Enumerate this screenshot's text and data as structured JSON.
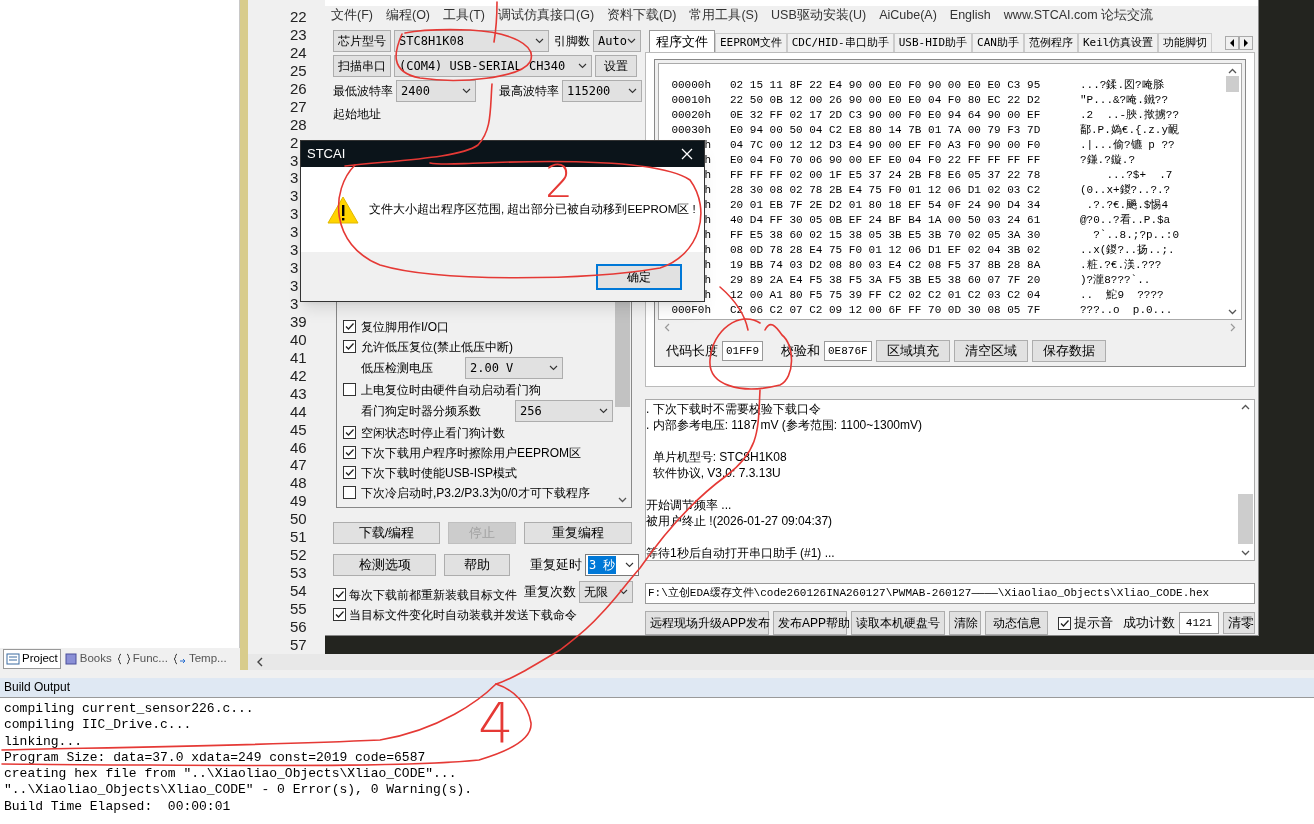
{
  "editor": {
    "line_numbers": [
      "22",
      "23",
      "24",
      "25",
      "26",
      "27",
      "28",
      "2",
      "3",
      "3",
      "3",
      "3",
      "3",
      "3",
      "3",
      "3",
      "3",
      "39",
      "40",
      "41",
      "42",
      "43",
      "44",
      "45",
      "46",
      "47",
      "48",
      "49",
      "50",
      "51",
      "52",
      "53",
      "54",
      "55",
      "56",
      "57"
    ],
    "panel_tabs": [
      {
        "label": "Project",
        "selected": true
      },
      {
        "label": "Books",
        "selected": false
      },
      {
        "label": "Func...",
        "selected": false
      },
      {
        "label": "Temp...",
        "selected": false
      }
    ]
  },
  "build_output": {
    "title": "Build Output",
    "lines": [
      "compiling current_sensor226.c...",
      "compiling IIC_Drive.c...",
      "linking...",
      "Program Size: data=37.0 xdata=249 const=2019 code=6587",
      "creating hex file from \"..\\Xiaoliao_Objects\\Xliao_CODE\"...",
      "\"..\\Xiaoliao_Objects\\Xliao_CODE\" - 0 Error(s), 0 Warning(s).",
      "Build Time Elapsed:  00:00:01"
    ]
  },
  "isp": {
    "menu": [
      "文件(F)",
      "编程(O)",
      "工具(T)",
      "调试仿真接口(G)",
      "资料下载(D)",
      "常用工具(S)",
      "USB驱动安装(U)",
      "AiCube(A)",
      "English",
      "www.STCAI.com 论坛交流"
    ],
    "chip": {
      "button": "芯片型号",
      "value": "STC8H1K08",
      "pins_label": "引脚数",
      "pins_value": "Auto"
    },
    "port": {
      "button": "扫描串口",
      "value": "(COM4) USB-SERIAL CH340",
      "settings": "设置"
    },
    "baud": {
      "min_label": "最低波特率",
      "min_value": "2400",
      "max_label": "最高波特率",
      "max_value": "115200"
    },
    "start_address_label": "起始地址",
    "options": [
      {
        "kind": "checkbox",
        "label": "复位脚用作I/O口",
        "checked": true
      },
      {
        "kind": "checkbox",
        "label": "允许低压复位(禁止低压中断)",
        "checked": true
      },
      {
        "kind": "select",
        "label": "低压检测电压",
        "value": "2.00 V"
      },
      {
        "kind": "checkbox",
        "label": "上电复位时由硬件自动启动看门狗",
        "checked": false
      },
      {
        "kind": "select",
        "label": "看门狗定时器分频系数",
        "value": "256"
      },
      {
        "kind": "checkbox",
        "label": "空闲状态时停止看门狗计数",
        "checked": true
      },
      {
        "kind": "checkbox",
        "label": "下次下载用户程序时擦除用户EEPROM区",
        "checked": true
      },
      {
        "kind": "checkbox",
        "label": "下次下载时使能USB-ISP模式",
        "checked": true
      },
      {
        "kind": "checkbox",
        "label": "下次冷启动时,P3.2/P3.3为0/0才可下载程序",
        "checked": false
      }
    ],
    "actions": [
      {
        "label": "下载/编程",
        "disabled": false
      },
      {
        "label": "停止",
        "disabled": true
      },
      {
        "label": "重复编程",
        "disabled": false
      },
      {
        "label": "检测选项",
        "disabled": false
      },
      {
        "label": "帮助",
        "disabled": false
      }
    ],
    "repeat_delay": {
      "label": "重复延时",
      "value": "3 秒"
    },
    "repeat_count": {
      "label": "重复次数",
      "value": "无限"
    },
    "bottom_options": [
      {
        "label": "每次下载前都重新装载目标文件",
        "checked": true
      },
      {
        "label": "当目标文件变化时自动装载并发送下载命令",
        "checked": true
      }
    ],
    "tabs": [
      {
        "label": "程序文件",
        "selected": true
      },
      {
        "label": "EEPROM文件",
        "selected": false
      },
      {
        "label": "CDC/HID-串口助手",
        "selected": false
      },
      {
        "label": "USB-HID助手",
        "selected": false
      },
      {
        "label": "CAN助手",
        "selected": false
      },
      {
        "label": "范例程序",
        "selected": false
      },
      {
        "label": "Keil仿真设置",
        "selected": false
      },
      {
        "label": "功能脚切",
        "selected": false
      }
    ],
    "hex_rows": [
      {
        "address": "00000h",
        "bytes": "02 15 11 8F 22 E4 90 00 E0 F0 90 00 E0 E0 C3 95",
        "ascii": "...?鍒.図?唵脎"
      },
      {
        "address": "00010h",
        "bytes": "22 50 0B 12 00 26 90 00 E0 E0 04 F0 80 EC 22 D2",
        "ascii": "\"P...&?唵.鐵??"
      },
      {
        "address": "00020h",
        "bytes": "0E 32 FF 02 17 2D C3 90 00 F0 E0 94 64 90 00 EF",
        "ascii": ".2  ..-脥.揿擄??"
      },
      {
        "address": "00030h",
        "bytes": "E0 94 00 50 04 C2 E8 80 14 7B 01 7A 00 79 F3 7D",
        "ascii": "鄐.P.媯€.{.z.y靦"
      },
      {
        "address": "h",
        "bytes": "04 7C 00 12 12 D3 E4 90 00 EF F0 A3 F0 90 00 F0",
        "ascii": ".|...偷?镳 p ??"
      },
      {
        "address": "h",
        "bytes": "E0 04 F0 70 06 90 00 EF E0 04 F0 22 FF FF FF FF",
        "ascii": "?鎌.?鏇.?"
      },
      {
        "address": "h",
        "bytes": "FF FF FF 02 00 1F E5 37 24 2B F8 E6 05 37 22 78",
        "ascii": "    ...?$+  .7"
      },
      {
        "address": "h",
        "bytes": "28 30 08 02 78 2B E4 75 F0 01 12 06 D1 02 03 C2",
        "ascii": "(0..x+鍐?..?.?"
      },
      {
        "address": "h",
        "bytes": "20 01 EB 7F 2E D2 01 80 18 EF 54 0F 24 90 D4 34",
        "ascii": " .?.?€.飈.$惕4"
      },
      {
        "address": "h",
        "bytes": "40 D4 FF 30 05 0B EF 24 BF B4 1A 00 50 03 24 61",
        "ascii": "@?0..?看..P.$a"
      },
      {
        "address": "h",
        "bytes": "FF E5 38 60 02 15 38 05 3B E5 3B 70 02 05 3A 30",
        "ascii": "  ?`..8.;?p..:0"
      },
      {
        "address": "h",
        "bytes": "08 0D 78 28 E4 75 F0 01 12 06 D1 EF 02 04 3B 02",
        "ascii": "..x(鍐?..扬..;."
      },
      {
        "address": "h",
        "bytes": "19 BB 74 03 D2 08 80 03 E4 C2 08 F5 37 8B 28 8A",
        "ascii": ".粧.?€.渼.???"
      },
      {
        "address": "h",
        "bytes": "29 89 2A E4 F5 38 F5 3A F5 3B E5 38 60 07 7F 20",
        "ascii": ")?瀧8???`.."
      },
      {
        "address": "h",
        "bytes": "12 00 A1 80 F5 75 39 FF C2 02 C2 01 C2 03 C2 04",
        "ascii": "..  鮀9  ????"
      },
      {
        "address": "000F0h",
        "bytes": "C2 06 C2 07 C2 09 12 00 6F FF 70 0D 30 08 05 7F",
        "ascii": "???..o  p.0..."
      }
    ],
    "code_length": {
      "label": "代码长度",
      "value": "01FF9"
    },
    "checksum": {
      "label": "校验和",
      "value": "0E876F"
    },
    "hex_buttons": [
      "区域填充",
      "清空区域",
      "保存数据"
    ],
    "log": [
      [
        ". 下次下载时不需要校验下载口令",
        ". 内部参考电压: 1187 mV (参考范围: 1100~1300mV)"
      ],
      [
        "  单片机型号: STC8H1K08",
        "  软件协议, V3.0: 7.3.13U"
      ],
      [
        "开始调节频率 ...",
        "被用户终止 !(2026-01-27 09:04:37)"
      ],
      [
        "等待1秒后自动打开串口助手 (#1) ..."
      ]
    ],
    "file_path": "F:\\立创EDA缓存文件\\code260126INA260127\\PWMAB-260127————\\Xiaoliao_Objects\\Xliao_CODE.hex",
    "footer_buttons": [
      "远程现场升级APP发布",
      "发布APP帮助",
      "读取本机硬盘号",
      "清除",
      "动态信息"
    ],
    "beep": {
      "label": "提示音",
      "checked": true
    },
    "success_count": {
      "label": "成功计数",
      "value": "4121",
      "reset": "清零"
    }
  },
  "dialog": {
    "title": "STCAI",
    "message": "文件大小超出程序区范围, 超出部分已被自动移到EEPROM区 !",
    "ok": "确定"
  },
  "annotations": [
    {
      "label": "2"
    },
    {
      "label": "4"
    }
  ]
}
